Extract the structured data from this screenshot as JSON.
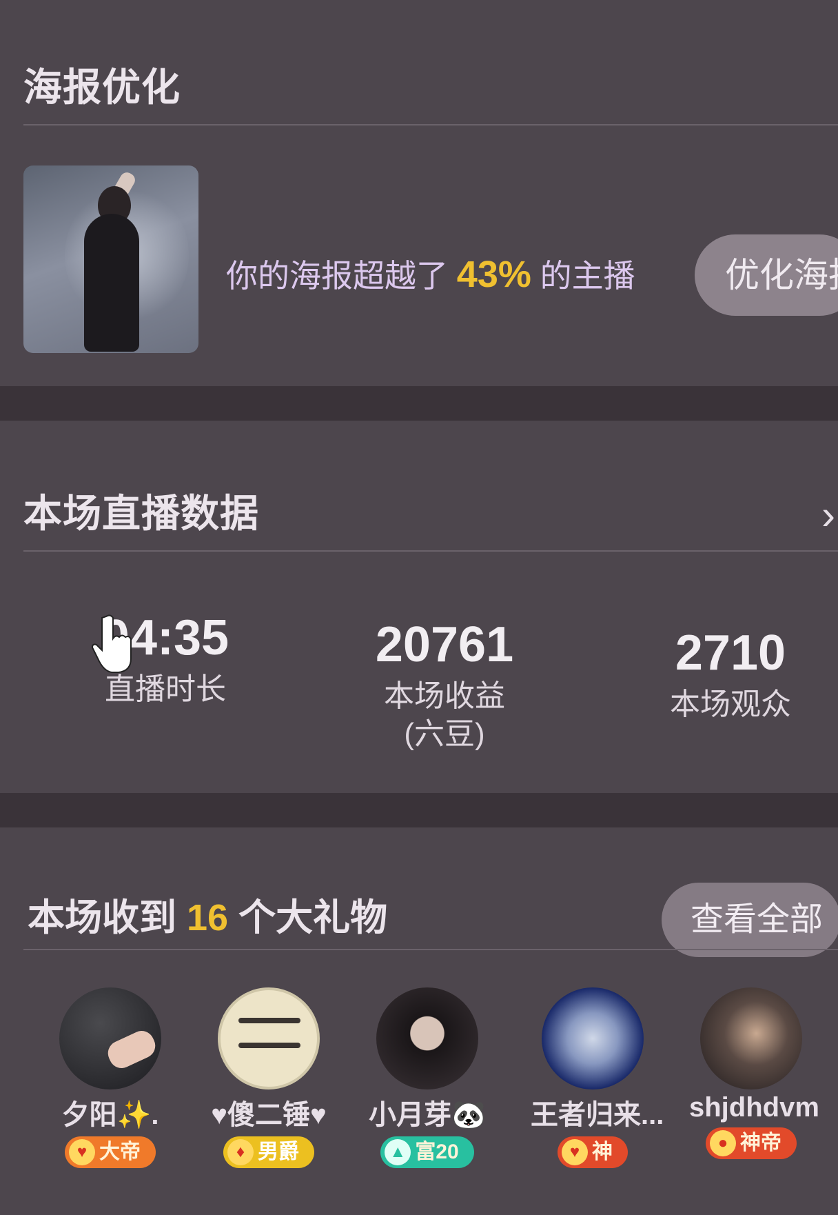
{
  "poster_section": {
    "title": "海报优化",
    "text_before": "你的海报超越了",
    "percent": "43%",
    "text_after": "的主播",
    "optimize_button": "优化海报"
  },
  "stats_section": {
    "title": "本场直播数据",
    "chevron": "›",
    "stats": [
      {
        "value": "04:35",
        "label": "直播时长",
        "sublabel": ""
      },
      {
        "value": "20761",
        "label": "本场收益",
        "sublabel": "(六豆)"
      },
      {
        "value": "2710",
        "label": "本场观众",
        "sublabel": ""
      }
    ]
  },
  "gifts_section": {
    "title_before": "本场收到",
    "count": "16",
    "title_after": "个大礼物",
    "view_all_button": "查看全部",
    "users": [
      {
        "name": "夕阳✨.",
        "badge": "大帝",
        "badge_color": "#f07a2a"
      },
      {
        "name": "♥傻二锤♥",
        "badge": "男爵",
        "badge_color": "#ecc020"
      },
      {
        "name": "小月芽🐼",
        "badge": "富20",
        "badge_color": "#28c0a0"
      },
      {
        "name": "王者归来...",
        "badge": "神",
        "badge_color": "#e24a2a"
      },
      {
        "name": "shjdhdvm",
        "badge": "神帝",
        "badge_color": "#e24a2a"
      }
    ]
  }
}
